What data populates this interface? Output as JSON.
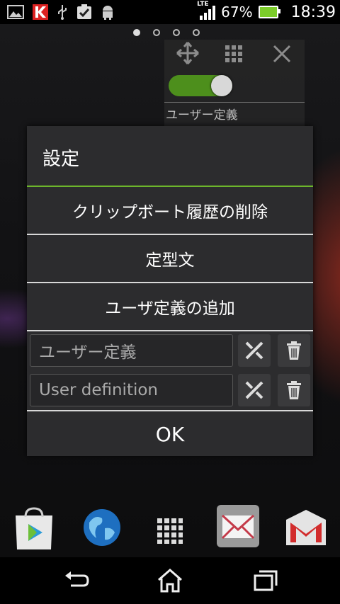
{
  "status_bar": {
    "notification_icons": [
      "image-icon",
      "k-app-icon",
      "usb-icon",
      "clipboard-check-icon",
      "android-icon"
    ],
    "network_label": "LTE",
    "battery_percent": "67%",
    "time": "18:39"
  },
  "home": {
    "page_count": 4,
    "active_page": 1,
    "widget": {
      "toggle_on": true,
      "label": "ユーザー定義"
    }
  },
  "dialog": {
    "title": "設定",
    "items": [
      "クリップボート履歴の削除",
      "定型文",
      "ユーザ定義の追加"
    ],
    "user_definitions": [
      {
        "value": "ユーザー定義"
      },
      {
        "value": "User definition"
      }
    ],
    "ok_label": "OK",
    "accent_color": "#6db62b"
  },
  "dock": [
    "play-store-icon",
    "browser-globe-icon",
    "app-drawer-icon",
    "email-icon",
    "gmail-icon"
  ],
  "navbar": [
    "back-icon",
    "home-icon",
    "recent-apps-icon"
  ]
}
